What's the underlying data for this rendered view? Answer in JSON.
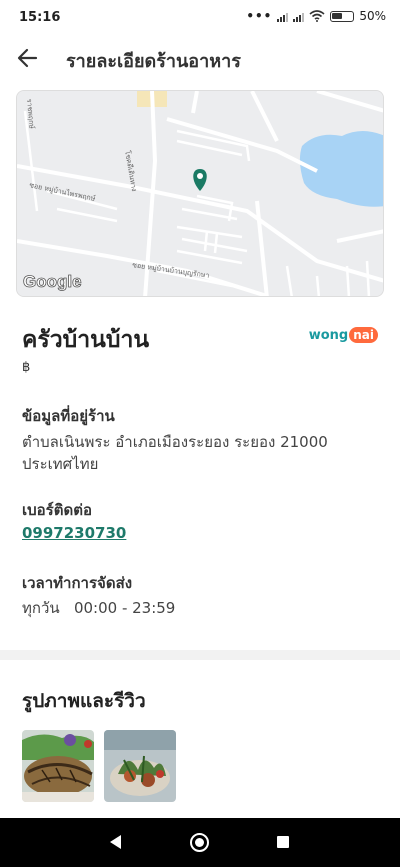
{
  "status_bar": {
    "time": "15:16",
    "dots": "•••",
    "battery_percent": "50%"
  },
  "header": {
    "title": "รายละเอียดร้านอาหาร",
    "back_icon": "arrow-left-icon"
  },
  "map": {
    "provider_label": "Google",
    "street_labels": [
      "โชคดีเดินทาง",
      "ซอย หมู่บ้านไพรพฤกษ์",
      "ซอย หมู่บ้านบ้านบุญรักษา",
      "ราชพฤกษ์"
    ],
    "pin_color": "#1a7a64",
    "water_color": "#a8d3f5"
  },
  "restaurant": {
    "name": "ครัวบ้านบ้าน",
    "price_level": "฿",
    "source_logo": {
      "text_main": "wong",
      "text_badge": "nai"
    }
  },
  "address": {
    "label": "ข้อมูลที่อยู่ร้าน",
    "line1": "ตำบลเนินพระ อำเภอเมืองระยอง ระยอง 21000",
    "line2": "ประเทศไทย"
  },
  "contact": {
    "label": "เบอร์ติดต่อ",
    "phone": "0997230730"
  },
  "delivery_hours": {
    "label": "เวลาทำการจัดส่ง",
    "value": "ทุกวัน   00:00 - 23:59"
  },
  "gallery": {
    "title": "รูปภาพและรีวิว",
    "photos": [
      "grilled-fish-photo",
      "salad-photo"
    ]
  },
  "navigation": {
    "back_icon": "nav-back-icon",
    "home_icon": "nav-home-icon",
    "recents_icon": "nav-recents-icon"
  },
  "colors": {
    "accent_green": "#1e7a6a",
    "brand_wongnai_teal": "#1a9aa0",
    "brand_wongnai_orange": "#ff6a3d"
  }
}
